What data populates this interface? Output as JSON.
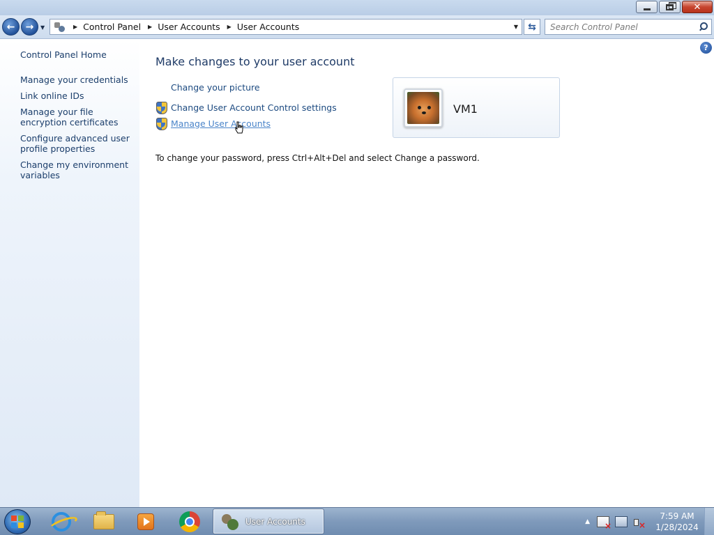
{
  "window": {
    "minimize_icon": "minimize-icon",
    "maximize_icon": "restore-icon",
    "close_icon": "close-icon"
  },
  "nav": {
    "back_icon": "back-arrow-icon",
    "forward_icon": "forward-arrow-icon",
    "breadcrumb": [
      "Control Panel",
      "User Accounts",
      "User Accounts"
    ],
    "refresh_icon": "refresh-icon",
    "search_placeholder": "Search Control Panel"
  },
  "sidebar": {
    "home": "Control Panel Home",
    "items": [
      {
        "label": "Manage your credentials"
      },
      {
        "label": "Link online IDs"
      },
      {
        "label": "Manage your file encryption certificates"
      },
      {
        "label": "Configure advanced user profile properties"
      },
      {
        "label": "Change my environment variables"
      }
    ]
  },
  "main": {
    "heading": "Make changes to your user account",
    "tasks": [
      {
        "label": "Change your picture",
        "shield": false
      },
      {
        "label": "Change User Account Control settings",
        "shield": true
      },
      {
        "label": "Manage User Accounts",
        "shield": true,
        "hover": true
      }
    ],
    "note": "To change your password, press Ctrl+Alt+Del and select Change a password."
  },
  "user": {
    "name": "VM1",
    "avatar": "pomeranian-dog-picture"
  },
  "taskbar": {
    "pinned": [
      "internet-explorer-icon",
      "windows-explorer-icon",
      "media-player-icon",
      "chrome-icon"
    ],
    "active_window": "User Accounts",
    "time": "7:59 AM",
    "date": "1/28/2024"
  },
  "colors": {
    "link": "#1c4a80",
    "link_hover": "#4a84c9",
    "heading": "#1e3a66"
  }
}
